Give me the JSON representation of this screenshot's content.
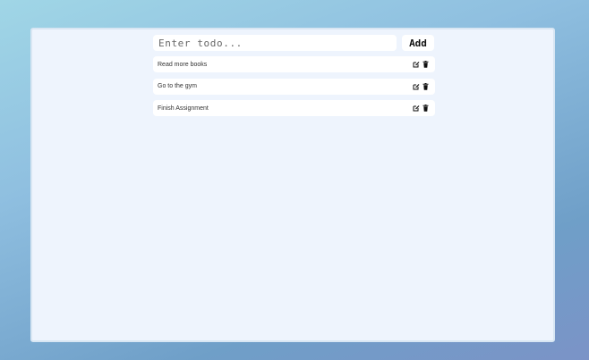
{
  "form": {
    "input_placeholder": "Enter todo...",
    "input_value": "",
    "add_label": "Add"
  },
  "todos": [
    {
      "text": "Read more books",
      "edit_icon": "edit-icon",
      "delete_icon": "trash-icon"
    },
    {
      "text": "Go to the gym",
      "edit_icon": "edit-icon",
      "delete_icon": "trash-icon"
    },
    {
      "text": "Finish Assignment",
      "edit_icon": "edit-icon",
      "delete_icon": "trash-icon"
    }
  ],
  "colors": {
    "panel_bg": "#eef4fd",
    "item_bg": "#ffffff",
    "text": "#333333",
    "icon": "#111111"
  }
}
